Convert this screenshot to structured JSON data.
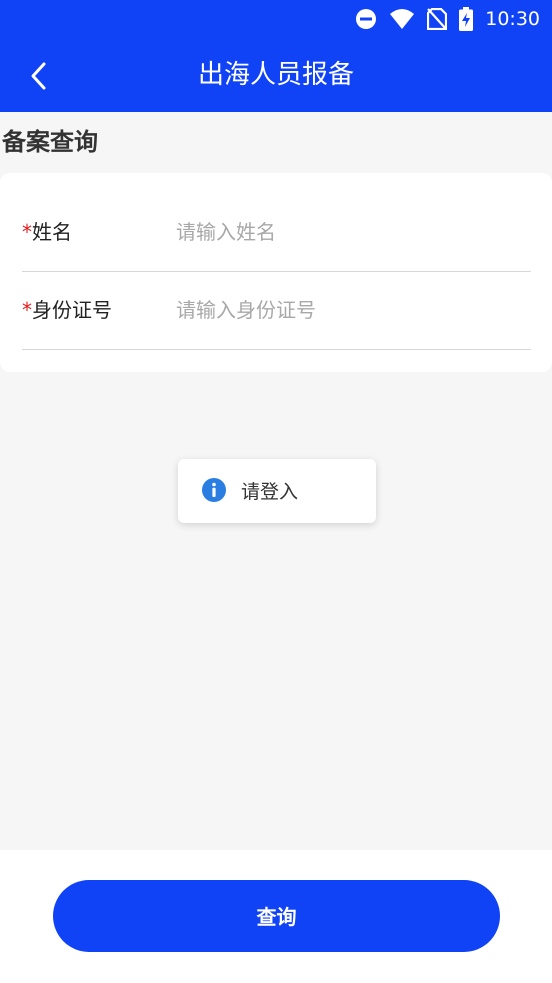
{
  "status_bar": {
    "time": "10:30",
    "icons": [
      "do-not-disturb-icon",
      "wifi-icon",
      "no-sim-icon",
      "battery-charging-icon"
    ]
  },
  "app_bar": {
    "title": "出海人员报备",
    "back_icon": "chevron-left-icon"
  },
  "section": {
    "title": "备案查询"
  },
  "form": {
    "fields": [
      {
        "required_mark": "*",
        "label": "姓名",
        "placeholder": "请输入姓名",
        "value": ""
      },
      {
        "required_mark": "*",
        "label": "身份证号",
        "placeholder": "请输入身份证号",
        "value": ""
      }
    ]
  },
  "toast": {
    "icon": "info-icon",
    "message": "请登入"
  },
  "actions": {
    "query_label": "查询"
  },
  "colors": {
    "primary": "#1043f5",
    "required": "#e01d1d",
    "background": "#f6f6f6",
    "info": "#2a7de1"
  }
}
